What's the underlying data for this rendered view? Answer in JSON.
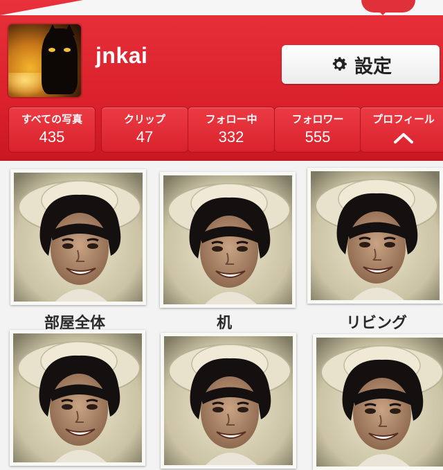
{
  "profile": {
    "username": "jnkai",
    "settings_label": "設定"
  },
  "stats": [
    {
      "label": "すべての写真",
      "value": "435"
    },
    {
      "label": "クリップ",
      "value": "47"
    },
    {
      "label": "フォロー中",
      "value": "332"
    },
    {
      "label": "フォロワー",
      "value": "555"
    },
    {
      "label": "プロフィール",
      "value": ""
    }
  ],
  "photos": [
    {
      "caption": "部屋全体"
    },
    {
      "caption": "机"
    },
    {
      "caption": "リビング"
    },
    {
      "caption": ""
    },
    {
      "caption": ""
    },
    {
      "caption": ""
    }
  ],
  "icons": {
    "settings": "gear-icon",
    "profile_toggle": "chevron-up-icon",
    "notification": "notification-bubble-icon"
  },
  "colors": {
    "header_red": "#d81f2a",
    "button_white": "#ffffff"
  }
}
